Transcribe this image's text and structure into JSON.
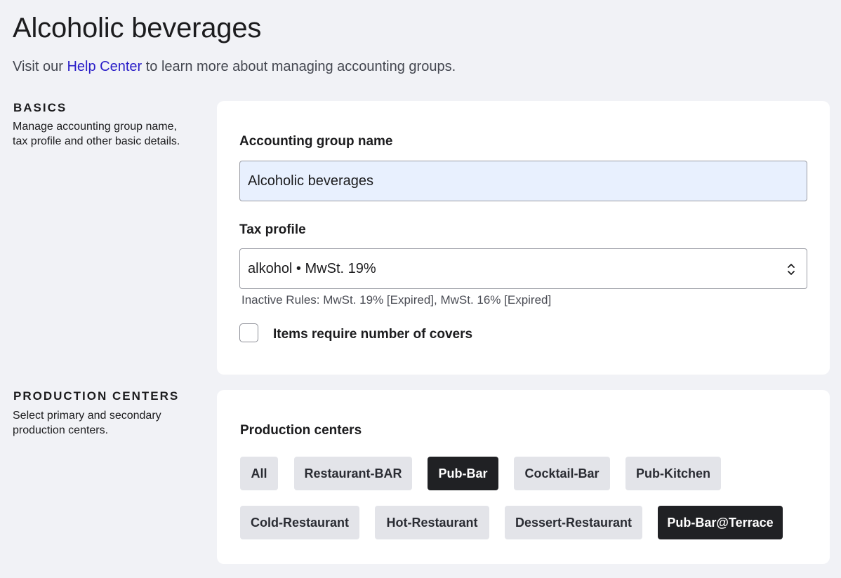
{
  "header": {
    "title": "Alcoholic beverages",
    "subtitle_prefix": "Visit our ",
    "help_link": "Help Center",
    "subtitle_suffix": " to learn more about managing accounting groups."
  },
  "basics": {
    "section_title": "BASICS",
    "section_desc": "Manage accounting group name, tax profile and other basic details.",
    "name_label": "Accounting group name",
    "name_value": "Alcoholic beverages",
    "tax_label": "Tax profile",
    "tax_value": "alkohol • MwSt. 19%",
    "inactive_rules": "Inactive Rules: MwSt. 19% [Expired], MwSt. 16% [Expired]",
    "covers_label": "Items require number of covers",
    "covers_checked": false
  },
  "production": {
    "section_title": "PRODUCTION CENTERS",
    "section_desc": "Select primary and secondary production centers.",
    "label": "Production centers",
    "chips": [
      {
        "label": "All",
        "selected": false
      },
      {
        "label": "Restaurant-BAR",
        "selected": false
      },
      {
        "label": "Pub-Bar",
        "selected": true
      },
      {
        "label": "Cocktail-Bar",
        "selected": false
      },
      {
        "label": "Pub-Kitchen",
        "selected": false
      },
      {
        "label": "Cold-Restaurant",
        "selected": false
      },
      {
        "label": "Hot-Restaurant",
        "selected": false
      },
      {
        "label": "Dessert-Restaurant",
        "selected": false
      },
      {
        "label": "Pub-Bar@Terrace",
        "selected": true
      }
    ]
  },
  "colors": {
    "link": "#2a1ec8",
    "chip_selected_bg": "#202124",
    "chip_bg": "#e3e4e9",
    "input_autofill_bg": "#e8f0fe",
    "page_bg": "#f1f2f6"
  }
}
